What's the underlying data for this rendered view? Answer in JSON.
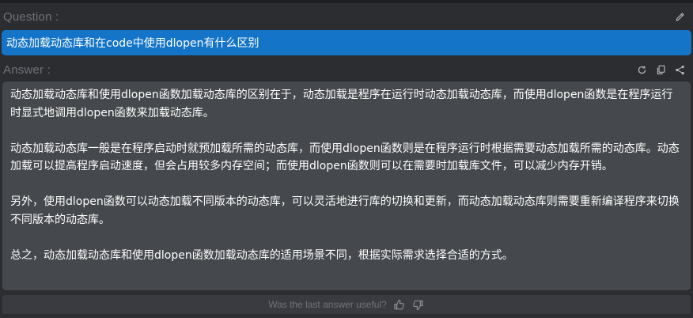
{
  "question": {
    "label": "Question :",
    "text": "动态加载动态库和在code中使用dlopen有什么区别",
    "edit_icon": "pencil-icon"
  },
  "answer": {
    "label": "Answer :",
    "icons": [
      "refresh-icon",
      "copy-icon",
      "share-icon"
    ],
    "paragraphs": [
      "动态加载动态库和使用dlopen函数加载动态库的区别在于，动态加载是程序在运行时动态加载动态库，而使用dlopen函数是在程序运行时显式地调用dlopen函数来加载动态库。",
      "动态加载动态库一般是在程序启动时就预加载所需的动态库，而使用dlopen函数则是在程序运行时根据需要动态加载所需的动态库。动态加载可以提高程序启动速度，但会占用较多内存空间；而使用dlopen函数则可以在需要时加载库文件，可以减少内存开销。",
      "另外，使用dlopen函数可以动态加载不同版本的动态库，可以灵活地进行库的切换和更新，而动态加载动态库则需要重新编译程序来切换不同版本的动态库。",
      "总之，动态加载动态库和使用dlopen函数加载动态库的适用场景不同，根据实际需求选择合适的方式。"
    ]
  },
  "feedback": {
    "prompt": "Was the last answer useful?",
    "icons": [
      "thumbs-up-icon",
      "thumbs-down-icon"
    ]
  },
  "colors": {
    "background": "#2b2d30",
    "question_bg": "#1474c8",
    "answer_bg": "#45484d",
    "label": "#6f737a"
  }
}
